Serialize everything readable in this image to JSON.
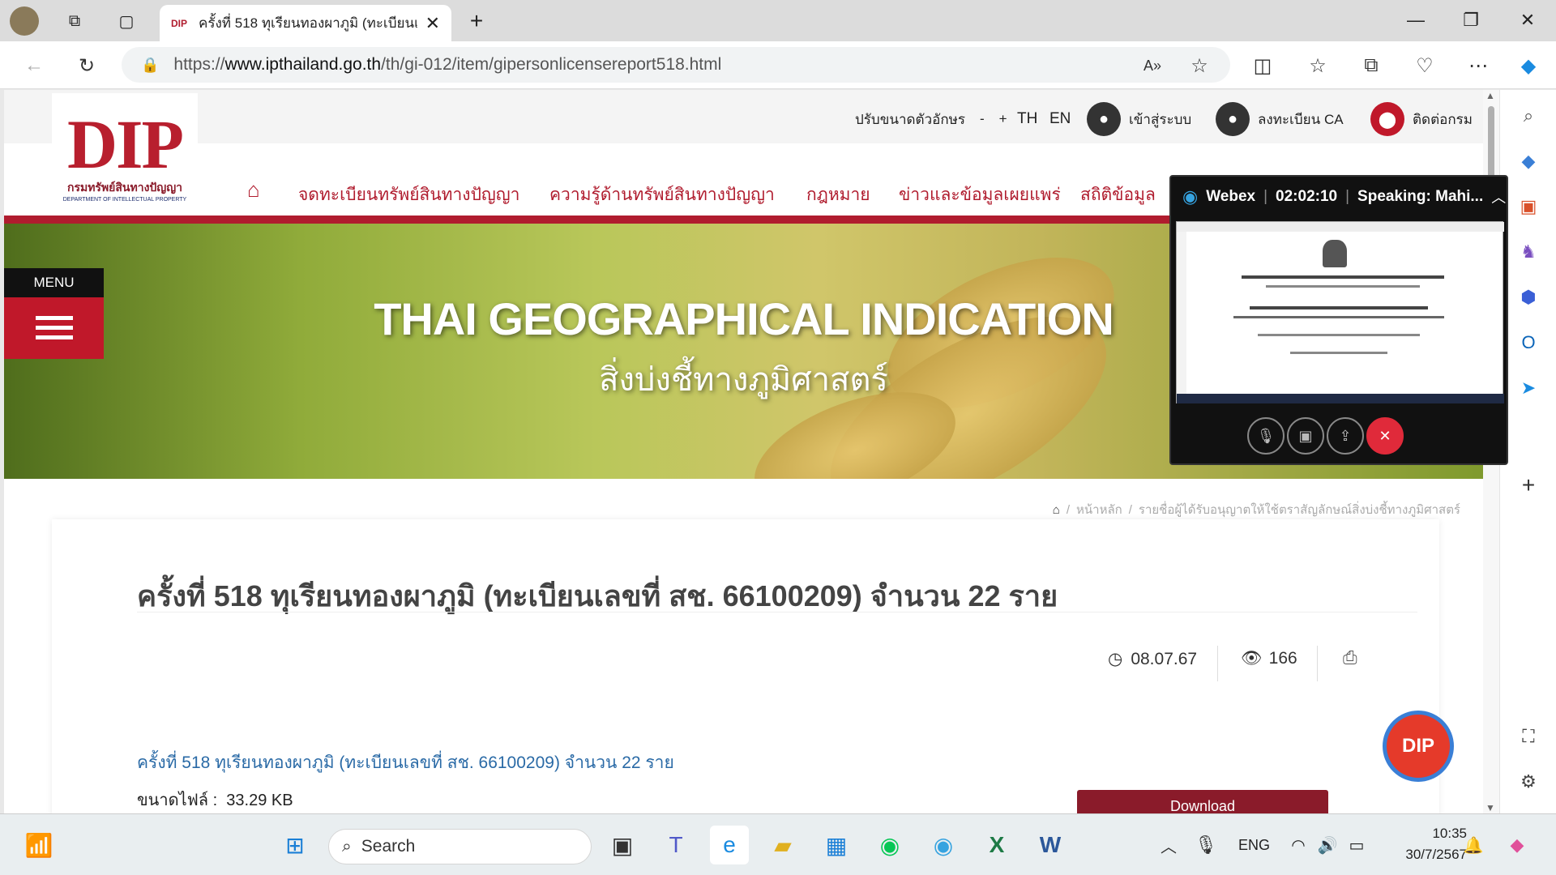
{
  "browser": {
    "tab_title": "ครั้งที่ 518 ทุเรียนทองผาภูมิ (ทะเบียนเ",
    "tab_favicon": "DIP",
    "url_scheme": "https://",
    "url_host": "www.ipthailand.go.th",
    "url_path": "/th/gi-012/item/gipersonlicensereport518.html"
  },
  "site": {
    "logo_text": "DIP",
    "logo_th": "กรมทรัพย์สินทางปัญญา",
    "logo_en": "DEPARTMENT OF INTELLECTUAL PROPERTY",
    "font_size_label": "ปรับขนาดตัวอักษร",
    "font_minus": "-",
    "font_plus": "+",
    "lang_th": "TH",
    "lang_en": "EN",
    "login": "เข้าสู่ระบบ",
    "register_ca": "ลงทะเบียน CA",
    "contact": "ติดต่อกรม",
    "nav": [
      "จดทะเบียนทรัพย์สินทางปัญญา",
      "ความรู้ด้านทรัพย์สินทางปัญญา",
      "กฎหมาย",
      "ข่าวและข้อมูลเผยแพร่",
      "สถิติข้อมูล"
    ],
    "menu_label": "MENU",
    "banner_title": "THAI GEOGRAPHICAL INDICATION",
    "banner_subtitle": "สิ่งบ่งชี้ทางภูมิศาสตร์",
    "breadcrumb": [
      "หน้าหลัก",
      "รายชื่อผู้ได้รับอนุญาตให้ใช้ตราสัญลักษณ์สิ่งบ่งชี้ทางภูมิศาสตร์"
    ],
    "accent_color": "#b01c2e"
  },
  "article": {
    "title": "ครั้งที่ 518 ทุเรียนทองผาภูมิ (ทะเบียนเลขที่ สช. 66100209) จำนวน 22 ราย",
    "date": "08.07.67",
    "views": "166",
    "file_link": "ครั้งที่ 518 ทุเรียนทองผาภูมิ (ทะเบียนเลขที่ สช. 66100209) จำนวน 22 ราย",
    "file_size_label": "ขนาดไฟล์ :",
    "file_size": "33.29 KB",
    "download_label": "Download"
  },
  "webex": {
    "app": "Webex",
    "timer": "02:02:10",
    "speaking": "Speaking: Mahi..."
  },
  "taskbar": {
    "search_placeholder": "Search",
    "lang": "ENG",
    "time": "10:35",
    "date": "30/7/2567"
  }
}
